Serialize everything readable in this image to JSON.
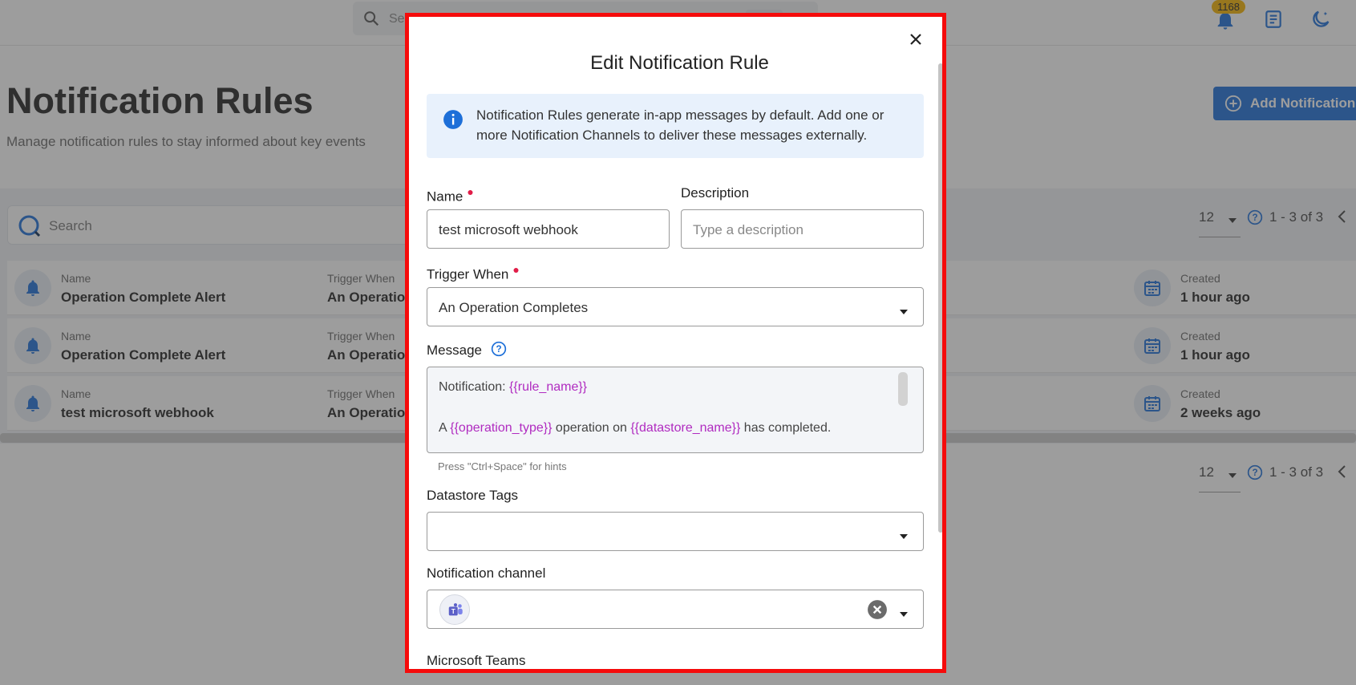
{
  "topbar": {
    "search_placeholder": "Search",
    "notification_count": "1168"
  },
  "page": {
    "title": "Notification Rules",
    "subtitle": "Manage notification rules to stay informed about key events",
    "add_button_label": "Add Notification"
  },
  "list": {
    "search_placeholder": "Search",
    "page_size": "12",
    "range": "1 - 3 of 3",
    "rows": [
      {
        "name_label": "Name",
        "name": "Operation Complete Alert",
        "trigger_label": "Trigger When",
        "trigger": "An Operation",
        "created_label": "Created",
        "created": "1 hour ago"
      },
      {
        "name_label": "Name",
        "name": "Operation Complete Alert",
        "trigger_label": "Trigger When",
        "trigger": "An Operation",
        "created_label": "Created",
        "created": "1 hour ago"
      },
      {
        "name_label": "Name",
        "name": "test microsoft webhook",
        "trigger_label": "Trigger When",
        "trigger": "An Operation",
        "created_label": "Created",
        "created": "2 weeks ago"
      }
    ]
  },
  "modal": {
    "title": "Edit Notification Rule",
    "info_text": "Notification Rules generate in-app messages by default. Add one or more Notification Channels to deliver these messages externally.",
    "name_label": "Name",
    "name_value": "test microsoft webhook",
    "description_label": "Description",
    "description_placeholder": "Type a description",
    "trigger_label": "Trigger When",
    "trigger_value": "An Operation Completes",
    "message_label": "Message",
    "message": {
      "line1_prefix": "Notification: ",
      "line1_var": "{{rule_name}}",
      "line2_a": "A ",
      "line2_var1": "{{operation_type}}",
      "line2_b": " operation on ",
      "line2_var2": "{{datastore_name}}",
      "line2_c": " has completed."
    },
    "hint": "Press \"Ctrl+Space\" for hints",
    "datastore_tags_label": "Datastore Tags",
    "channel_label": "Notification channel",
    "section_microsoft_teams": "Microsoft Teams"
  },
  "colors": {
    "accent": "#1d6fd8",
    "highlight_border": "#f50b0b",
    "template_variable": "#b02bc0",
    "required": "#e11d48"
  }
}
